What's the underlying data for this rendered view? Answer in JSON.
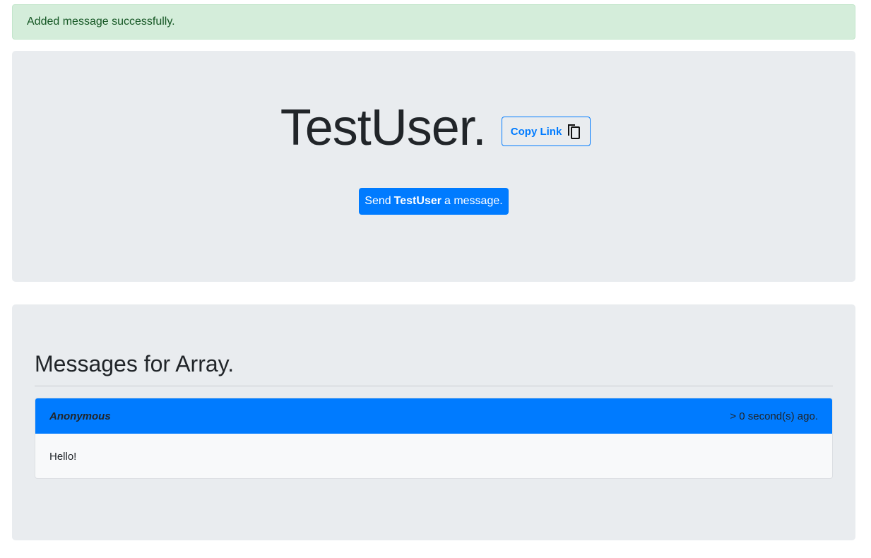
{
  "alert": {
    "text": "Added message successfully."
  },
  "profile": {
    "title": "TestUser.",
    "copy_link_label": "Copy Link",
    "copy_icon": "copy-icon",
    "send_prefix": "Send",
    "send_user": "TestUser",
    "send_suffix": "a message."
  },
  "messages": {
    "heading": "Messages for Array.",
    "items": [
      {
        "author": "Anonymous",
        "time": "> 0 second(s) ago.",
        "body": "Hello!"
      }
    ]
  },
  "colors": {
    "primary": "#007bff",
    "alert_bg": "#d4edda",
    "alert_text": "#155724",
    "panel_bg": "#e9ecef"
  }
}
